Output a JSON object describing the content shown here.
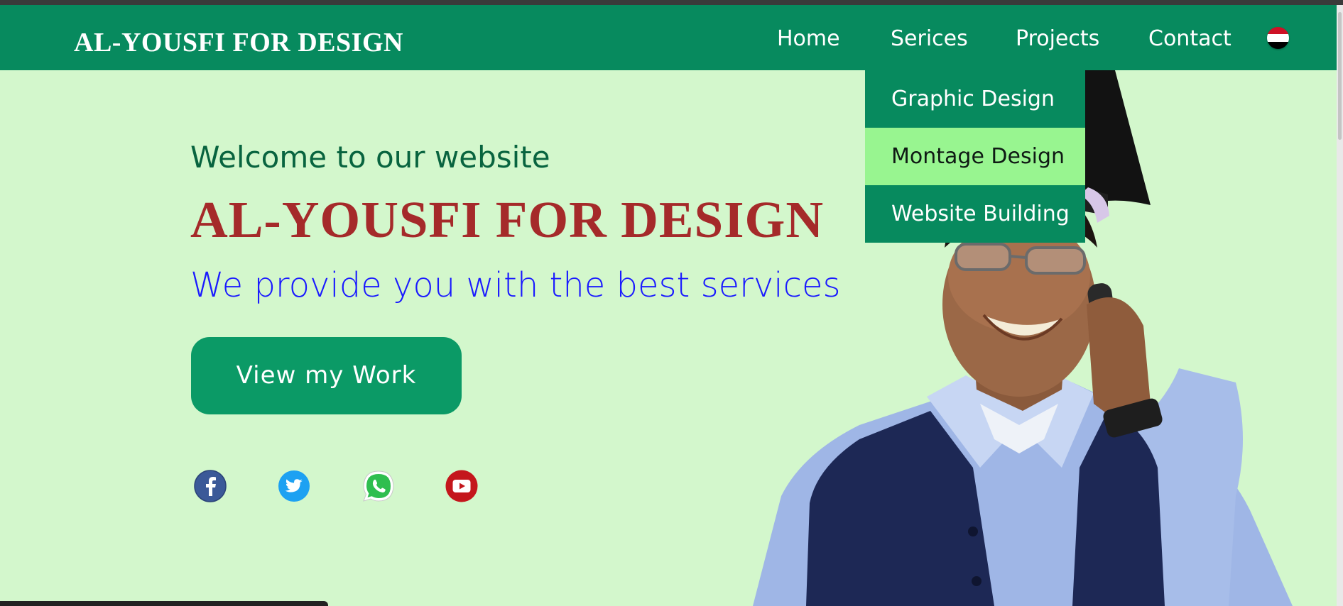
{
  "header": {
    "brand": "AL-YOUSFI FOR DESIGN",
    "nav": {
      "home": "Home",
      "services": "Serices",
      "projects": "Projects",
      "contact": "Contact"
    },
    "language_flag": "yemen-flag-icon"
  },
  "services_menu": {
    "items": [
      "Graphic Design",
      "Montage Design",
      "Website Building"
    ],
    "highlighted": "Montage Design"
  },
  "hero": {
    "welcome": "Welcome to our website",
    "headline": "AL-YOUSFI FOR DESIGN",
    "tagline": "We provide you with the best services",
    "cta_label": "View my Work"
  },
  "social": [
    "facebook-icon",
    "twitter-icon",
    "whatsapp-icon",
    "youtube-icon"
  ],
  "colors": {
    "nav_bg": "#078a5e",
    "page_bg": "#d3f7cc",
    "headline": "#a52a2a",
    "tagline": "#1a1aff",
    "cta_bg": "#0b9a66",
    "menu_highlight": "#98f590"
  }
}
